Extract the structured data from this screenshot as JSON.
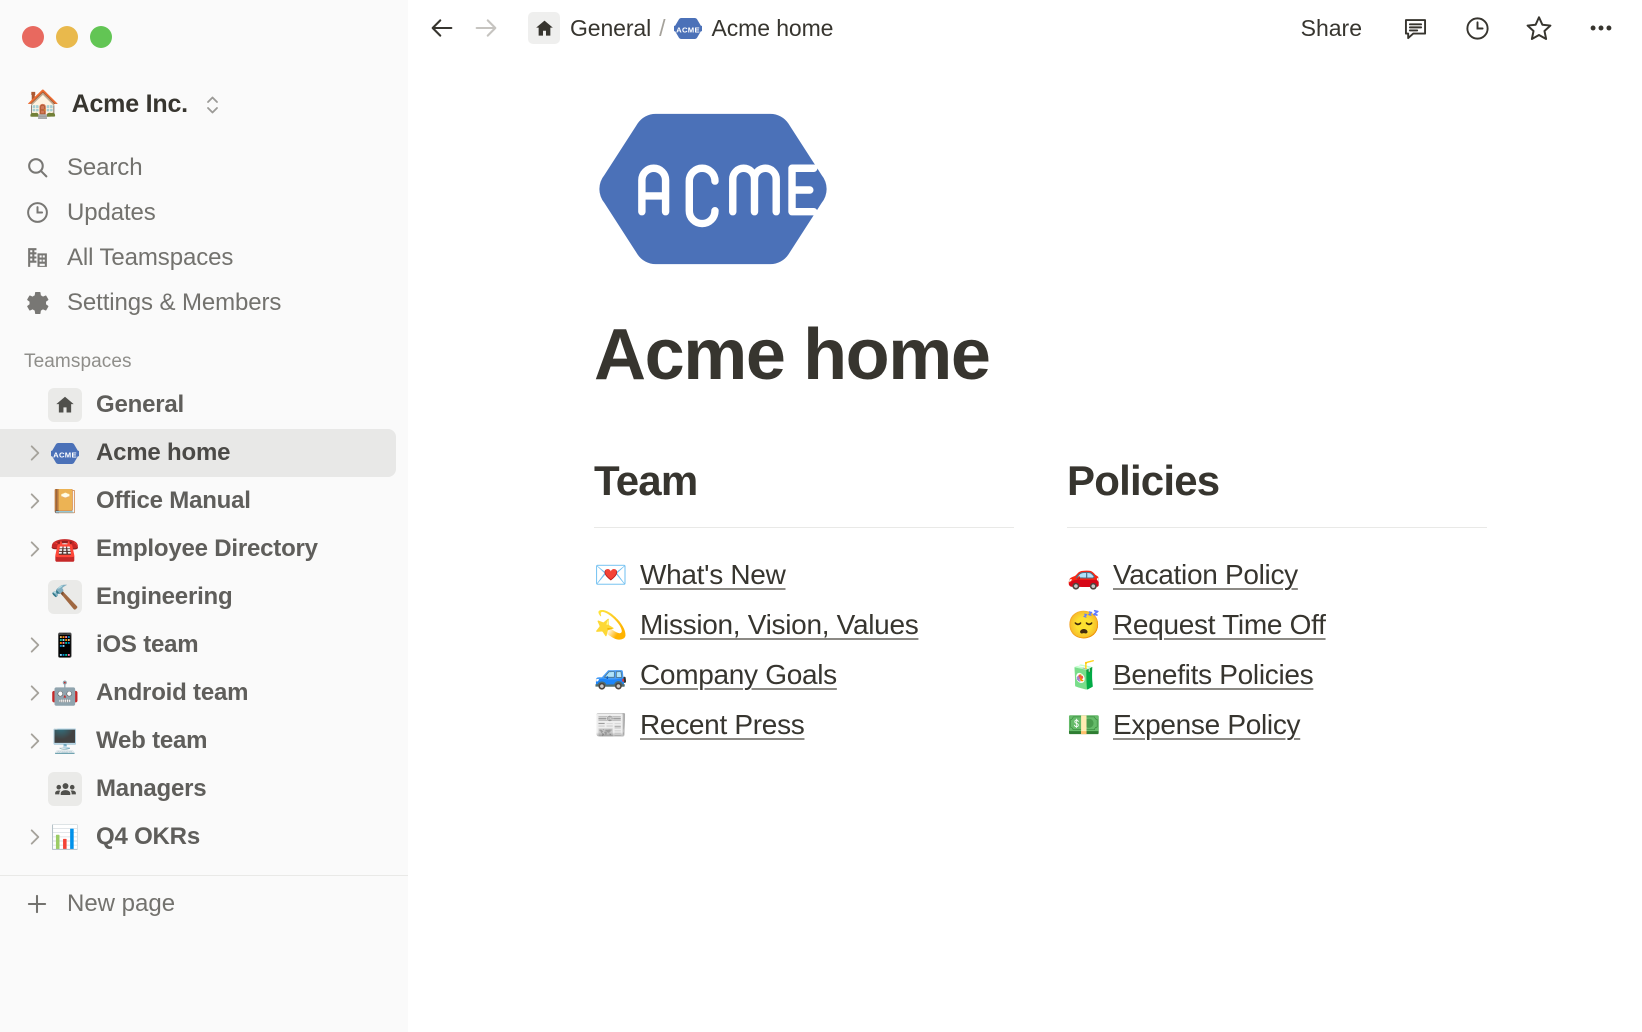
{
  "window": {
    "traffic_lights": [
      {
        "name": "close",
        "color": "#e8695f"
      },
      {
        "name": "minimize",
        "color": "#e9b94c"
      },
      {
        "name": "maximize",
        "color": "#62c554"
      }
    ]
  },
  "sidebar": {
    "workspace": {
      "emoji": "🏠",
      "name": "Acme Inc."
    },
    "nav": [
      {
        "icon": "search-icon",
        "label": "Search"
      },
      {
        "icon": "clock-icon",
        "label": "Updates"
      },
      {
        "icon": "building-icon",
        "label": "All Teamspaces"
      },
      {
        "icon": "gear-icon",
        "label": "Settings & Members"
      }
    ],
    "section_label": "Teamspaces",
    "teamspaces": [
      {
        "label": "General",
        "icon": "home-glyph",
        "emoji": "",
        "boxed": true,
        "chevron": false,
        "selected": false
      },
      {
        "label": "Acme home",
        "icon": "acme-badge",
        "emoji": "",
        "boxed": false,
        "chevron": true,
        "selected": true
      },
      {
        "label": "Office Manual",
        "icon": "emoji",
        "emoji": "📔",
        "boxed": false,
        "chevron": true,
        "selected": false
      },
      {
        "label": "Employee Directory",
        "icon": "emoji",
        "emoji": "☎️",
        "boxed": false,
        "chevron": true,
        "selected": false
      },
      {
        "label": "Engineering",
        "icon": "emoji",
        "emoji": "🔨",
        "boxed": true,
        "chevron": false,
        "selected": false
      },
      {
        "label": "iOS team",
        "icon": "emoji",
        "emoji": "📱",
        "boxed": false,
        "chevron": true,
        "selected": false
      },
      {
        "label": "Android team",
        "icon": "emoji",
        "emoji": "🤖",
        "boxed": false,
        "chevron": true,
        "selected": false
      },
      {
        "label": "Web team",
        "icon": "emoji",
        "emoji": "🖥️",
        "boxed": false,
        "chevron": true,
        "selected": false
      },
      {
        "label": "Managers",
        "icon": "people-glyph",
        "emoji": "",
        "boxed": true,
        "chevron": false,
        "selected": false
      },
      {
        "label": "Q4 OKRs",
        "icon": "emoji",
        "emoji": "📊",
        "boxed": false,
        "chevron": true,
        "selected": false
      }
    ],
    "new_page_label": "New page"
  },
  "topbar": {
    "back_icon": "arrow-left-icon",
    "forward_icon": "arrow-right-icon",
    "breadcrumb": {
      "home_icon": "home-icon",
      "parent": "General",
      "separator": "/",
      "current_icon": "acme-badge-icon",
      "current": "Acme home"
    },
    "share_label": "Share",
    "actions": [
      {
        "icon": "comment-icon"
      },
      {
        "icon": "history-clock-icon"
      },
      {
        "icon": "star-icon"
      },
      {
        "icon": "more-options-icon"
      }
    ]
  },
  "page": {
    "cover_logo": {
      "name": "acme-hexagon-logo",
      "text": "ACME",
      "color": "#4b71b8"
    },
    "title": "Acme home",
    "columns": [
      {
        "heading": "Team",
        "links": [
          {
            "emoji": "💌",
            "label": "What's New"
          },
          {
            "emoji": "💫",
            "label": "Mission, Vision, Values"
          },
          {
            "emoji": "🚙",
            "label": "Company Goals"
          },
          {
            "emoji": "📰",
            "label": "Recent Press"
          }
        ]
      },
      {
        "heading": "Policies",
        "links": [
          {
            "emoji": "🚗",
            "label": "Vacation Policy"
          },
          {
            "emoji": "😴",
            "label": "Request Time Off"
          },
          {
            "emoji": "🧃",
            "label": "Benefits Policies"
          },
          {
            "emoji": "💵",
            "label": "Expense Policy"
          }
        ]
      }
    ]
  },
  "colors": {
    "sidebar_bg": "#fafafa",
    "selected_row": "#e8e8e7",
    "text_primary": "#37352f",
    "text_secondary": "#73726e",
    "divider": "#e9e9e7",
    "brand_blue": "#4b71b8"
  }
}
